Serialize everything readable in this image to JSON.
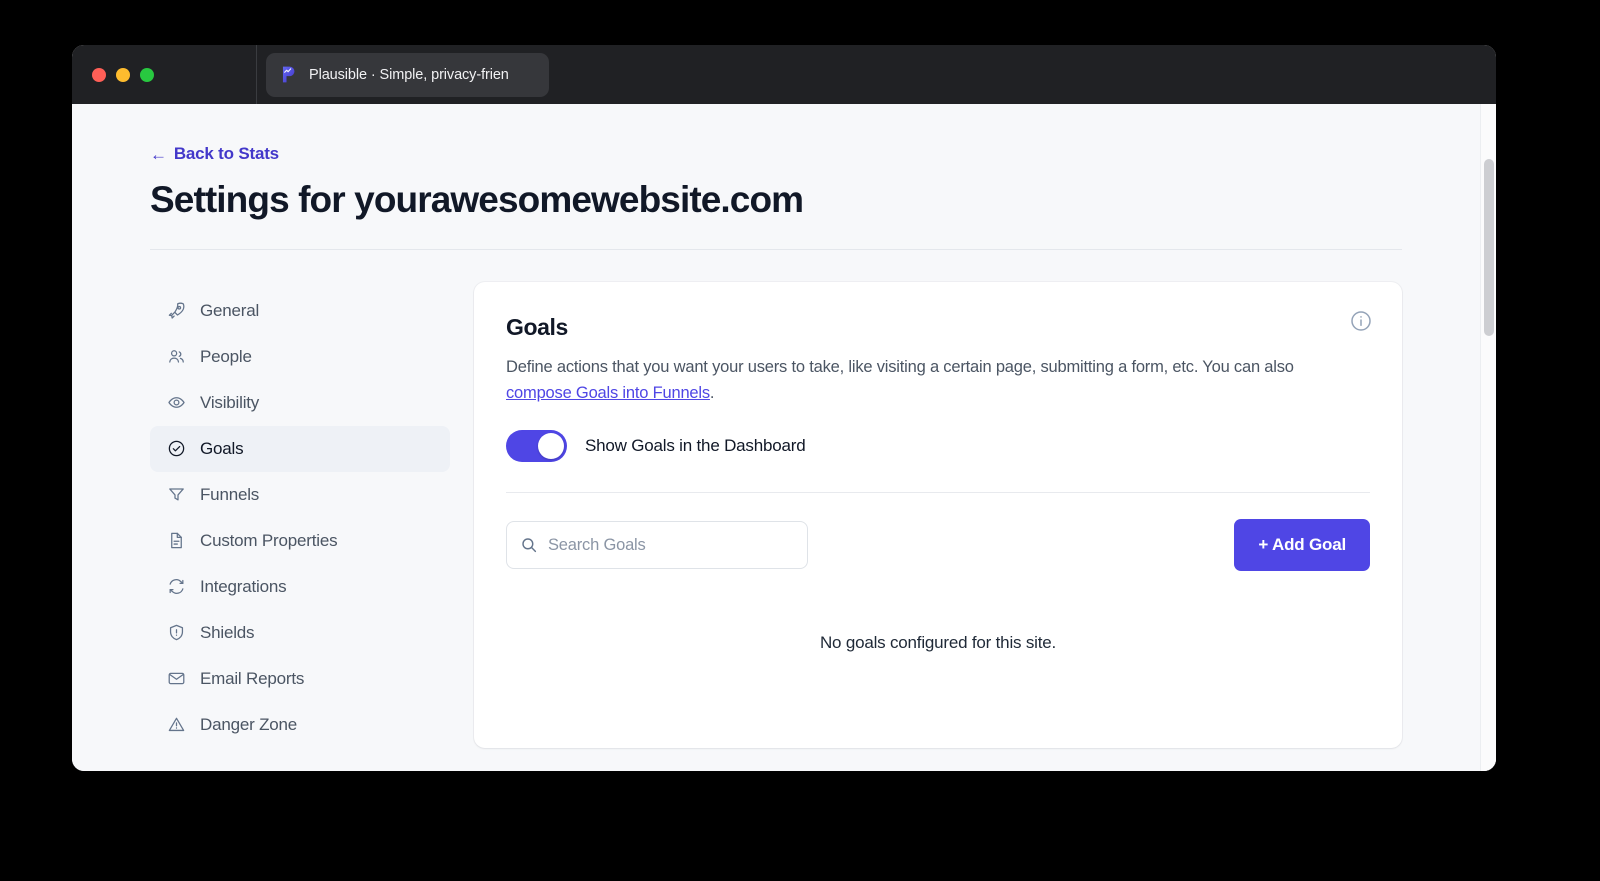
{
  "browser": {
    "traffic_lights": [
      {
        "name": "close",
        "color": "#ff5f57"
      },
      {
        "name": "minimize",
        "color": "#febc2e"
      },
      {
        "name": "maximize",
        "color": "#28c840"
      }
    ],
    "tab": {
      "title": "Plausible · Simple, privacy-frien",
      "favicon": "plausible-logo-icon"
    }
  },
  "header": {
    "back_link": "Back to Stats",
    "back_arrow": "←",
    "title": "Settings for yourawesomewebsite.com"
  },
  "sidebar": {
    "items": [
      {
        "label": "General",
        "icon": "rocket-icon",
        "active": false
      },
      {
        "label": "People",
        "icon": "people-icon",
        "active": false
      },
      {
        "label": "Visibility",
        "icon": "eye-icon",
        "active": false
      },
      {
        "label": "Goals",
        "icon": "check-circle-icon",
        "active": true
      },
      {
        "label": "Funnels",
        "icon": "funnel-icon",
        "active": false
      },
      {
        "label": "Custom Properties",
        "icon": "document-icon",
        "active": false
      },
      {
        "label": "Integrations",
        "icon": "sync-icon",
        "active": false
      },
      {
        "label": "Shields",
        "icon": "shield-icon",
        "active": false
      },
      {
        "label": "Email Reports",
        "icon": "envelope-icon",
        "active": false
      },
      {
        "label": "Danger Zone",
        "icon": "warning-triangle-icon",
        "active": false
      }
    ]
  },
  "card": {
    "title": "Goals",
    "info_icon": "info-circle-icon",
    "description_line1": "Define actions that you want your users to take, like visiting a certain page, submitting a form, etc.",
    "description_line2_prefix": "You can also ",
    "description_link": "compose Goals into Funnels",
    "description_line2_suffix": ".",
    "toggle": {
      "label": "Show Goals in the Dashboard",
      "state": "on"
    },
    "search": {
      "placeholder": "Search Goals",
      "value": "",
      "icon": "search-icon"
    },
    "add_button": "+ Add Goal",
    "empty_state": "No goals configured for this site."
  },
  "colors": {
    "accent": "#4f46e5",
    "link": "#4338ca",
    "page_background": "#f7f8fa",
    "card_background": "#ffffff",
    "titlebar": "#202124",
    "active_nav_background": "#eef1f6"
  }
}
